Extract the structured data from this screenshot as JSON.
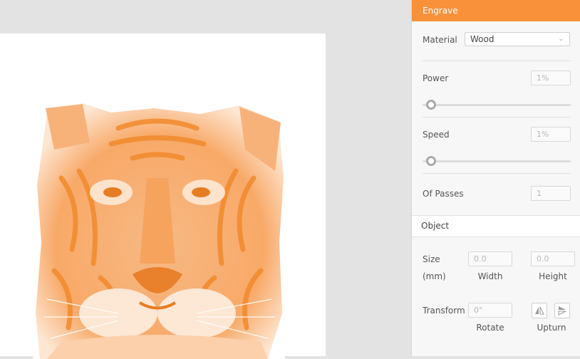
{
  "panel": {
    "title": "Engrave",
    "material": {
      "label": "Material",
      "selected": "Wood"
    },
    "power": {
      "label": "Power",
      "value": "1%",
      "slider_fraction": 0.01
    },
    "speed": {
      "label": "Speed",
      "value": "1%",
      "slider_fraction": 0.01
    },
    "passes": {
      "label": "Of Passes",
      "value": "1"
    }
  },
  "object": {
    "title": "Object",
    "size": {
      "label": "Size",
      "unit": "(mm)",
      "width_value": "0.0",
      "height_value": "0.0",
      "width_label": "Width",
      "height_label": "Height"
    },
    "transform": {
      "label": "Transform",
      "rotate_value": "0°",
      "rotate_label": "Rotate",
      "upturn_label": "Upturn"
    }
  },
  "colors": {
    "accent": "#f8913a",
    "artwork_tint": "#f8913a"
  },
  "icons": {
    "select_chevron": "chevron-down-icon",
    "flip_horizontal": "flip-horizontal-icon",
    "flip_vertical": "flip-vertical-icon"
  }
}
